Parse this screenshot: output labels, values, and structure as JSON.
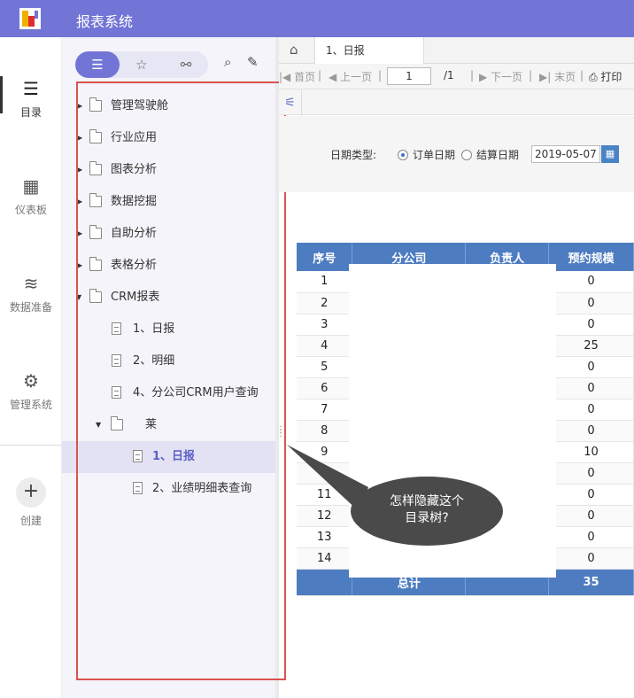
{
  "app": {
    "title": "报表系统"
  },
  "rail": {
    "items": [
      {
        "label": "目录",
        "icon": "list-icon"
      },
      {
        "label": "仪表板",
        "icon": "dashboard-icon"
      },
      {
        "label": "数据准备",
        "icon": "database-icon"
      },
      {
        "label": "管理系统",
        "icon": "gear-icon"
      }
    ],
    "create_label": "创建"
  },
  "tree": {
    "nodes": [
      {
        "label": "管理驾驶舱",
        "type": "folder"
      },
      {
        "label": "行业应用",
        "type": "folder"
      },
      {
        "label": "图表分析",
        "type": "folder"
      },
      {
        "label": "数据挖掘",
        "type": "folder"
      },
      {
        "label": "自助分析",
        "type": "folder"
      },
      {
        "label": "表格分析",
        "type": "folder"
      },
      {
        "label": "CRM报表",
        "type": "folder",
        "expanded": true
      },
      {
        "label": "1、日报",
        "type": "file"
      },
      {
        "label": "2、明细",
        "type": "file"
      },
      {
        "label": "4、分公司CRM用户查询",
        "type": "file"
      },
      {
        "label": "莱",
        "type": "folder",
        "expanded": true
      },
      {
        "label": "1、日报",
        "type": "file",
        "selected": true
      },
      {
        "label": "2、业绩明细表查询",
        "type": "file"
      }
    ]
  },
  "tab": {
    "label": "1、日报"
  },
  "pager": {
    "first": "首页",
    "prev": "上一页",
    "page": "1",
    "total": "/1",
    "next": "下一页",
    "last": "末页",
    "print": "打印"
  },
  "params": {
    "date_type_label": "日期类型:",
    "option_order": "订单日期",
    "option_settle": "结算日期",
    "date_value": "2019-05-07"
  },
  "table": {
    "headers": [
      "序号",
      "分公司",
      "负责人",
      "预约规模"
    ],
    "rows": [
      {
        "no": "1",
        "value": "0"
      },
      {
        "no": "2",
        "value": "0"
      },
      {
        "no": "3",
        "value": "0"
      },
      {
        "no": "4",
        "value": "25"
      },
      {
        "no": "5",
        "value": "0"
      },
      {
        "no": "6",
        "value": "0"
      },
      {
        "no": "7",
        "value": "0"
      },
      {
        "no": "8",
        "value": "0"
      },
      {
        "no": "9",
        "value": "10"
      },
      {
        "no": "",
        "value": "0"
      },
      {
        "no": "11",
        "value": "0"
      },
      {
        "no": "12",
        "value": "0"
      },
      {
        "no": "13",
        "value": "0"
      },
      {
        "no": "14",
        "value": "0"
      }
    ],
    "total_label": "总计",
    "total_value": "35"
  },
  "callout": {
    "line1": "怎样隐藏这个",
    "line2": "目录树?"
  },
  "colors": {
    "accent": "#7275d6",
    "table_header": "#4e7cc1",
    "highlight": "#d9534f"
  }
}
